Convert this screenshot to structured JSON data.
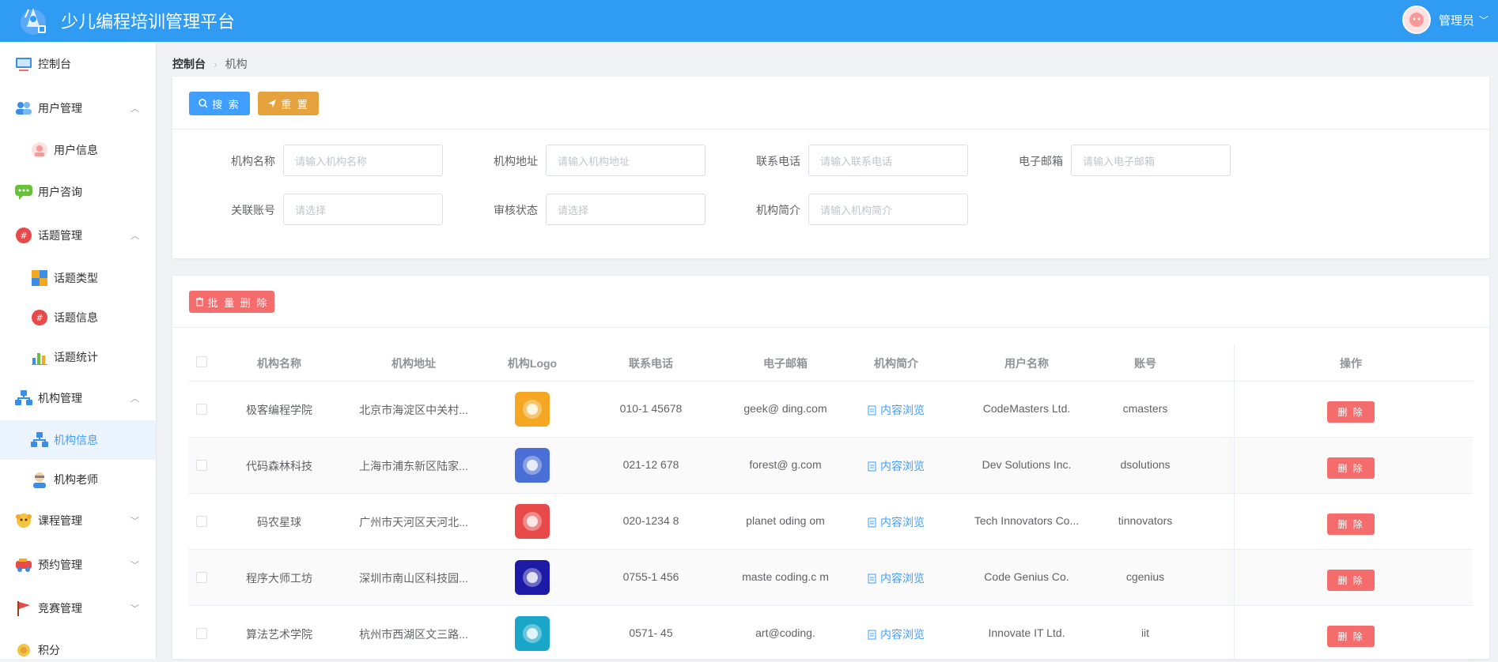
{
  "header": {
    "app_title": "少儿编程培训管理平台",
    "user_name": "管理员"
  },
  "sidebar": {
    "items": [
      {
        "label": "控制台",
        "icon": "dashboard-icon"
      },
      {
        "label": "用户管理",
        "icon": "users-icon"
      },
      {
        "label": "用户信息",
        "icon": "user-avatar-icon"
      },
      {
        "label": "用户咨询",
        "icon": "chat-icon"
      },
      {
        "label": "话题管理",
        "icon": "topic-icon"
      },
      {
        "label": "话题类型",
        "icon": "blocks-icon"
      },
      {
        "label": "话题信息",
        "icon": "hash-icon"
      },
      {
        "label": "话题统计",
        "icon": "bar-chart-icon"
      },
      {
        "label": "机构管理",
        "icon": "org-icon"
      },
      {
        "label": "机构信息",
        "icon": "org-icon"
      },
      {
        "label": "机构老师",
        "icon": "teacher-icon"
      },
      {
        "label": "课程管理",
        "icon": "course-icon"
      },
      {
        "label": "预约管理",
        "icon": "booking-icon"
      },
      {
        "label": "竞赛管理",
        "icon": "flag-icon"
      },
      {
        "label": "积分",
        "icon": "points-icon"
      }
    ]
  },
  "breadcrumb": {
    "root": "控制台",
    "current": "机构"
  },
  "search": {
    "search_label": "搜 索",
    "reset_label": "重 置",
    "fields": [
      {
        "label": "机构名称",
        "placeholder": "请输入机构名称"
      },
      {
        "label": "机构地址",
        "placeholder": "请输入机构地址"
      },
      {
        "label": "联系电话",
        "placeholder": "请输入联系电话"
      },
      {
        "label": "电子邮箱",
        "placeholder": "请输入电子邮箱"
      },
      {
        "label": "关联账号",
        "placeholder": "请选择"
      },
      {
        "label": "审核状态",
        "placeholder": "请选择"
      },
      {
        "label": "机构简介",
        "placeholder": "请输入机构简介"
      }
    ]
  },
  "table": {
    "batch_delete_label": "批 量 删 除",
    "columns": [
      "机构名称",
      "机构地址",
      "机构Logo",
      "联系电话",
      "电子邮箱",
      "机构简介",
      "用户名称",
      "账号",
      "操作"
    ],
    "view_label": "内容浏览",
    "delete_label": "删 除",
    "rows": [
      {
        "name": "极客编程学院",
        "address": "北京市海淀区中关村...",
        "phone": "010-1  45678",
        "email": "geek@   ding.com",
        "user": "CodeMasters Ltd.",
        "account": "cmasters",
        "logo_color": "#f5a623"
      },
      {
        "name": "代码森林科技",
        "address": "上海市浦东新区陆家...",
        "phone": "021-12   678",
        "email": "forest@     g.com",
        "user": "Dev Solutions Inc.",
        "account": "dsolutions",
        "logo_color": "#4a6fd6"
      },
      {
        "name": "码农星球",
        "address": "广州市天河区天河北...",
        "phone": "020-1234   8",
        "email": "planet   oding  om",
        "user": "Tech Innovators Co...",
        "account": "tinnovators",
        "logo_color": "#e84a4a"
      },
      {
        "name": "程序大师工坊",
        "address": "深圳市南山区科技园...",
        "phone": "0755-1   456  ",
        "email": "maste   coding.c  m",
        "user": "Code Genius Co.",
        "account": "cgenius",
        "logo_color": "#1d1aa8"
      },
      {
        "name": "算法艺术学院",
        "address": "杭州市西湖区文三路...",
        "phone": "0571-   45  ",
        "email": "art@coding.      ",
        "user": "Innovate IT Ltd.",
        "account": "iit",
        "logo_color": "#1aa6c9"
      }
    ]
  }
}
